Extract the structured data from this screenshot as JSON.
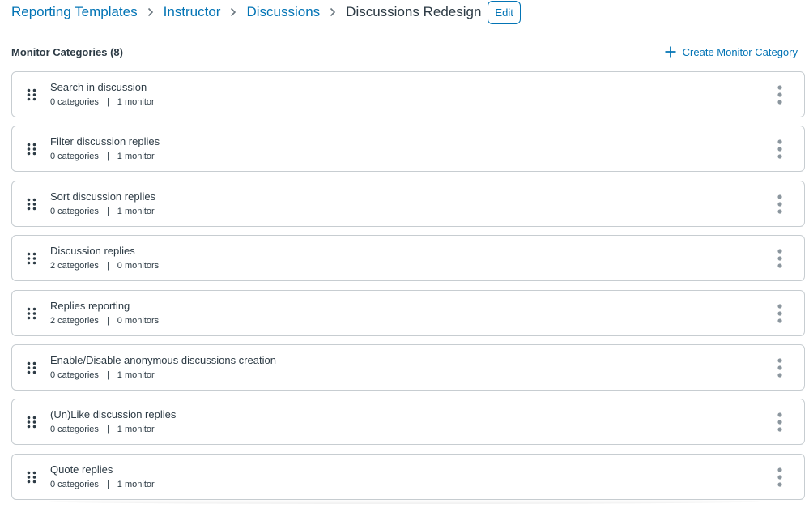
{
  "breadcrumb": {
    "items": [
      "Reporting Templates",
      "Instructor",
      "Discussions"
    ],
    "current": "Discussions Redesign",
    "edit_label": "Edit"
  },
  "section": {
    "title": "Monitor Categories (8)",
    "create_label": "Create Monitor Category"
  },
  "meta_separator": "|",
  "categories": [
    {
      "title": "Search in discussion",
      "categories": "0 categories",
      "monitors": "1 monitor"
    },
    {
      "title": "Filter discussion replies",
      "categories": "0 categories",
      "monitors": "1 monitor"
    },
    {
      "title": "Sort discussion replies",
      "categories": "0 categories",
      "monitors": "1 monitor"
    },
    {
      "title": "Discussion replies",
      "categories": "2 categories",
      "monitors": "0 monitors"
    },
    {
      "title": "Replies reporting",
      "categories": "2 categories",
      "monitors": "0 monitors"
    },
    {
      "title": "Enable/Disable anonymous discussions creation",
      "categories": "0 categories",
      "monitors": "1 monitor"
    },
    {
      "title": "(Un)Like discussion replies",
      "categories": "0 categories",
      "monitors": "1 monitor"
    },
    {
      "title": "Quote replies",
      "categories": "0 categories",
      "monitors": "1 monitor"
    }
  ],
  "icons": {
    "breadcrumb_separator": "chevron-right-icon",
    "create": "plus-icon",
    "drag": "drag-handle-icon",
    "menu": "kebab-menu-icon"
  },
  "colors": {
    "link": "#0374b5",
    "text": "#2d3b45",
    "border": "#c7cdd1",
    "icon_gray": "#8b969e"
  }
}
